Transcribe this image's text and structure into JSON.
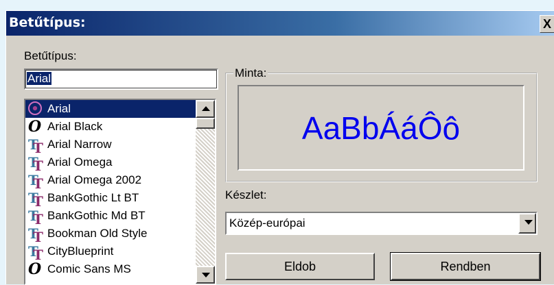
{
  "window": {
    "title": "Betűtípus:",
    "close_symbol": "X"
  },
  "font_label": "Betűtípus:",
  "font_input": {
    "value": "Arial"
  },
  "font_list": {
    "items": [
      {
        "label": "Arial",
        "icon": "opentype-icon",
        "selected": true
      },
      {
        "label": "Arial Black",
        "icon": "opentype-icon"
      },
      {
        "label": "Arial Narrow",
        "icon": "truetype-icon"
      },
      {
        "label": "Arial Omega",
        "icon": "truetype-icon"
      },
      {
        "label": "Arial Omega 2002",
        "icon": "truetype-icon"
      },
      {
        "label": "BankGothic Lt BT",
        "icon": "truetype-icon"
      },
      {
        "label": "BankGothic Md BT",
        "icon": "truetype-icon"
      },
      {
        "label": "Bookman Old Style",
        "icon": "truetype-icon"
      },
      {
        "label": "CityBlueprint",
        "icon": "truetype-icon"
      },
      {
        "label": "Comic Sans MS",
        "icon": "opentype-icon"
      }
    ]
  },
  "sample": {
    "label": "Minta:",
    "text": "AaBbÁáÔô",
    "color": "#0000ee"
  },
  "charset": {
    "label": "Készlet:",
    "value": "Közép-európai"
  },
  "buttons": {
    "cancel": "Eldob",
    "ok": "Rendben"
  }
}
